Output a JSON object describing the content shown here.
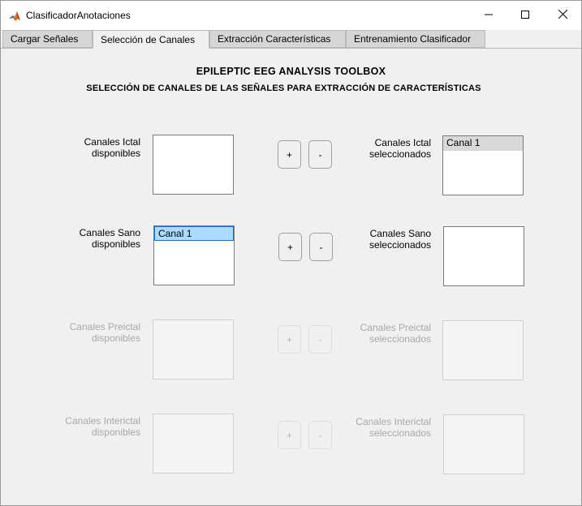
{
  "window": {
    "title": "ClasificadorAnotaciones",
    "icon": "matlab-icon",
    "controls": [
      "minimize-icon",
      "maximize-icon",
      "close-icon"
    ]
  },
  "tabs": [
    {
      "label": "Cargar Señales",
      "active": false
    },
    {
      "label": "Selección de Canales",
      "active": true
    },
    {
      "label": "Extracción Características",
      "active": false
    },
    {
      "label": "Entrenamiento Clasificador",
      "active": false
    }
  ],
  "headings": {
    "title": "EPILEPTIC EEG ANALYSIS TOOLBOX",
    "subtitle": "SELECCIÓN DE CANALES DE LAS SEÑALES PARA EXTRACCIÓN DE CARACTERÍSTICAS"
  },
  "groups": [
    {
      "available_label": [
        "Canales Ictal",
        "disponibles"
      ],
      "selected_label": [
        "Canales Ictal",
        "seleccionados"
      ],
      "available_items": [],
      "selected_items": [
        "Canal 1"
      ],
      "add_label": "+",
      "remove_label": "-",
      "enabled": true
    },
    {
      "available_label": [
        "Canales Sano",
        "disponibles"
      ],
      "selected_label": [
        "Canales Sano",
        "seleccionados"
      ],
      "available_items": [
        "Canal 1"
      ],
      "selected_items": [],
      "add_label": "+",
      "remove_label": "-",
      "enabled": true
    },
    {
      "available_label": [
        "Canales Preictal",
        "disponibles"
      ],
      "selected_label": [
        "Canales Preictal",
        "seleccionados"
      ],
      "available_items": [],
      "selected_items": [],
      "add_label": "+",
      "remove_label": "-",
      "enabled": false
    },
    {
      "available_label": [
        "Canales Interictal",
        "disponibles"
      ],
      "selected_label": [
        "Canales Interictal",
        "seleccionados"
      ],
      "available_items": [],
      "selected_items": [],
      "add_label": "+",
      "remove_label": "-",
      "enabled": false
    }
  ]
}
